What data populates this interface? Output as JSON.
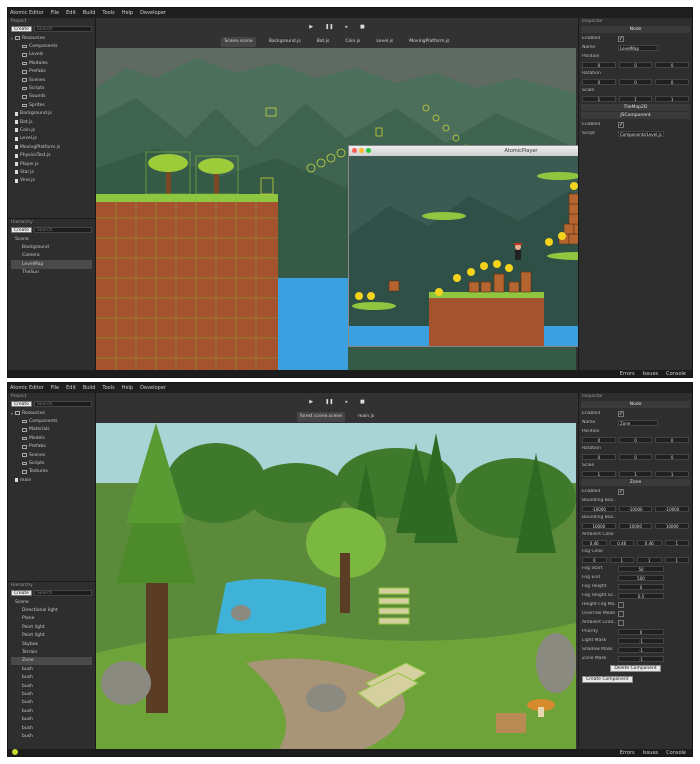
{
  "menu": [
    "Atomic Editor",
    "File",
    "Edit",
    "Build",
    "Tools",
    "Help",
    "Developer"
  ],
  "colors": {
    "accent": "#c7d72c",
    "panel": "#2e2e2e",
    "menubar": "#1f1f1f",
    "grass": "#8ec63f",
    "dirt": "#a4532e",
    "water": "#3aa0e0"
  },
  "editor1": {
    "project_label": "Project",
    "create_label": "Create",
    "search_placeholder": "Search",
    "tree": [
      {
        "label": "Resources",
        "kind": "folder",
        "depth": 0,
        "open": true
      },
      {
        "label": "Components",
        "kind": "folder",
        "depth": 1
      },
      {
        "label": "Levels",
        "kind": "folder",
        "depth": 1
      },
      {
        "label": "Modules",
        "kind": "folder",
        "depth": 1
      },
      {
        "label": "Prefabs",
        "kind": "folder",
        "depth": 1
      },
      {
        "label": "Scenes",
        "kind": "folder",
        "depth": 1
      },
      {
        "label": "Scripts",
        "kind": "folder",
        "depth": 1
      },
      {
        "label": "Sounds",
        "kind": "folder",
        "depth": 1
      },
      {
        "label": "Sprites",
        "kind": "folder",
        "depth": 1
      },
      {
        "label": "Background.js",
        "kind": "file",
        "depth": 0
      },
      {
        "label": "Bat.js",
        "kind": "file",
        "depth": 0
      },
      {
        "label": "Coin.js",
        "kind": "file",
        "depth": 0
      },
      {
        "label": "Level.js",
        "kind": "file",
        "depth": 0
      },
      {
        "label": "MovingPlatform.js",
        "kind": "file",
        "depth": 0
      },
      {
        "label": "PhysicsTest.js",
        "kind": "file",
        "depth": 0
      },
      {
        "label": "Player.js",
        "kind": "file",
        "depth": 0
      },
      {
        "label": "Star.js",
        "kind": "file",
        "depth": 0
      },
      {
        "label": "Vine.js",
        "kind": "file",
        "depth": 0
      }
    ],
    "hierarchy_label": "Hierarchy",
    "hierarchy": [
      {
        "label": "Scene",
        "depth": 0
      },
      {
        "label": "Background",
        "depth": 1
      },
      {
        "label": "Camera",
        "depth": 1
      },
      {
        "label": "LevelMap",
        "depth": 1,
        "selected": true
      },
      {
        "label": "TheSun",
        "depth": 1
      }
    ],
    "tabs": [
      {
        "label": "Scene.scene",
        "active": true
      },
      {
        "label": "Background.js"
      },
      {
        "label": "Bat.js"
      },
      {
        "label": "Coin.js"
      },
      {
        "label": "Level.js"
      },
      {
        "label": "MovingPlatform.js"
      }
    ],
    "inspector": {
      "title": "Inspector",
      "node_header": "Node",
      "enabled_label": "Enabled",
      "name_label": "Name",
      "name_value": "LevelMap",
      "position_label": "Position",
      "position": [
        "0",
        "0",
        "0"
      ],
      "rotation_label": "Rotation",
      "rotation": [
        "0",
        "0",
        "0"
      ],
      "scale_label": "Scale",
      "scale": [
        "1",
        "1",
        "1"
      ],
      "tilemap_header": "TileMap2D",
      "js_header": "JSComponent",
      "js_enabled_label": "Enabled",
      "script_label": "Script",
      "script_value": "Components/Level.js"
    },
    "player_title": "AtomicPlayer",
    "status": [
      "Errors",
      "Issues",
      "Console"
    ]
  },
  "editor2": {
    "project_label": "Project",
    "create_label": "Create",
    "search_placeholder": "Search",
    "tree": [
      {
        "label": "Resources",
        "kind": "folder",
        "depth": 0,
        "open": true
      },
      {
        "label": "Components",
        "kind": "folder",
        "depth": 1
      },
      {
        "label": "Materials",
        "kind": "folder",
        "depth": 1
      },
      {
        "label": "Models",
        "kind": "folder",
        "depth": 1
      },
      {
        "label": "Prefabs",
        "kind": "folder",
        "depth": 1
      },
      {
        "label": "Scenes",
        "kind": "folder",
        "depth": 1
      },
      {
        "label": "Scripts",
        "kind": "folder",
        "depth": 1
      },
      {
        "label": "Textures",
        "kind": "folder",
        "depth": 1
      },
      {
        "label": "main",
        "kind": "file",
        "depth": 0
      }
    ],
    "hierarchy_label": "Hierarchy",
    "hierarchy": [
      {
        "label": "Scene",
        "depth": 0
      },
      {
        "label": "Directional light",
        "depth": 1
      },
      {
        "label": "Plane",
        "depth": 1
      },
      {
        "label": "Point light",
        "depth": 1
      },
      {
        "label": "Point light",
        "depth": 1
      },
      {
        "label": "Skybox",
        "depth": 1
      },
      {
        "label": "Terrain",
        "depth": 1
      },
      {
        "label": "Zone",
        "depth": 1,
        "selected": true
      },
      {
        "label": "bush",
        "depth": 1
      },
      {
        "label": "bush",
        "depth": 1
      },
      {
        "label": "bush",
        "depth": 1
      },
      {
        "label": "bush",
        "depth": 1
      },
      {
        "label": "bush",
        "depth": 1
      },
      {
        "label": "bush",
        "depth": 1
      },
      {
        "label": "bush",
        "depth": 1
      },
      {
        "label": "bush",
        "depth": 1
      },
      {
        "label": "bush",
        "depth": 1
      }
    ],
    "tabs": [
      {
        "label": "forest scene.scene",
        "active": true
      },
      {
        "label": "main.js"
      }
    ],
    "inspector": {
      "title": "Inspector",
      "node_header": "Node",
      "enabled_label": "Enabled",
      "name_label": "Name",
      "name_value": "Zone",
      "position_label": "Position",
      "position": [
        "0",
        "0",
        "0"
      ],
      "rotation_label": "Rotation",
      "rotation": [
        "0",
        "0",
        "0"
      ],
      "scale_label": "Scale",
      "scale": [
        "1",
        "1",
        "1"
      ],
      "zone_header": "Zone",
      "zone_enabled_label": "Enabled",
      "bbox_min_label": "Bounding Box...",
      "bbox_min": [
        "-10000",
        "-10000",
        "-10000"
      ],
      "bbox_max_label": "Bounding Box...",
      "bbox_max": [
        "10000",
        "10000",
        "10000"
      ],
      "ambient_label": "Ambient Color",
      "ambient": [
        "0.46",
        "0.46",
        "0.46",
        "1"
      ],
      "fog_label": "Fog Color",
      "fog": [
        "0",
        "1",
        "1",
        "1"
      ],
      "props": [
        {
          "label": "Fog Start",
          "value": "50"
        },
        {
          "label": "Fog End",
          "value": "500"
        },
        {
          "label": "Fog Height",
          "value": "0"
        },
        {
          "label": "Fog Height Sc...",
          "value": "0.5"
        },
        {
          "label": "Height Fog Mo...",
          "value": ""
        },
        {
          "label": "Override Mode",
          "value": ""
        },
        {
          "label": "Ambient Grad...",
          "value": ""
        },
        {
          "label": "Priority",
          "value": "0"
        },
        {
          "label": "Light Mask",
          "value": "-1"
        },
        {
          "label": "Shadow Mask",
          "value": "-1"
        },
        {
          "label": "Zone Mask",
          "value": "-1"
        }
      ],
      "delete_label": "Delete Component",
      "create_component_label": "Create Component"
    },
    "status": [
      "Errors",
      "Issues",
      "Console"
    ]
  }
}
